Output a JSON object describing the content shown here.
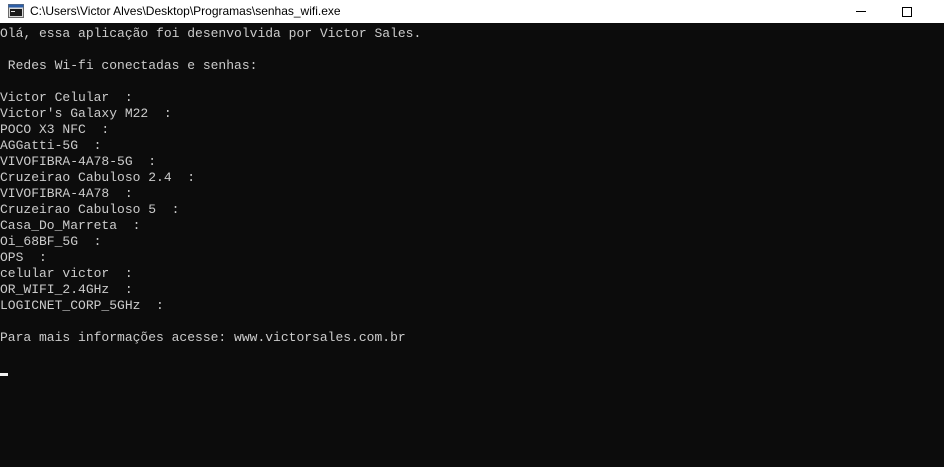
{
  "window": {
    "title": "C:\\Users\\Victor Alves\\Desktop\\Programas\\senhas_wifi.exe",
    "icon": "console-app-icon"
  },
  "console": {
    "intro": "Olá, essa aplicação foi desenvolvida por Victor Sales.",
    "header": " Redes Wi-fi conectadas e senhas:",
    "networks": [
      "Victor Celular  :",
      "Victor's Galaxy M22  :",
      "POCO X3 NFC  :",
      "AGGatti-5G  :",
      "VIVOFIBRA-4A78-5G  :",
      "Cruzeirao Cabuloso 2.4  :",
      "VIVOFIBRA-4A78  :",
      "Cruzeirao Cabuloso 5  :",
      "Casa_Do_Marreta  :",
      "Oi_68BF_5G  :",
      "OPS  :",
      "celular victor  :",
      "OR_WIFI_2.4GHz  :",
      "LOGICNET_CORP_5GHz  :"
    ],
    "footer": "Para mais informações acesse: www.victorsales.com.br"
  },
  "colors": {
    "background": "#0c0c0c",
    "text": "#cccccc",
    "titlebar": "#ffffff"
  }
}
